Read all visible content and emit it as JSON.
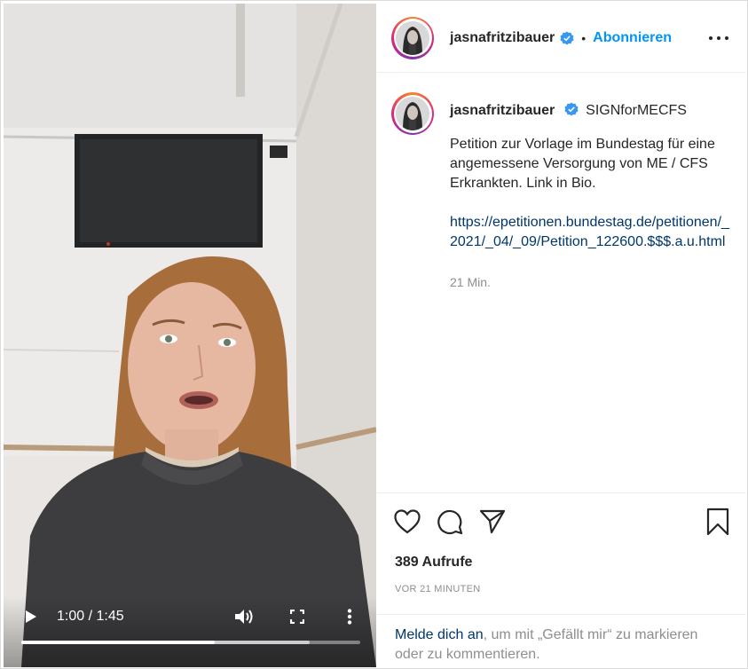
{
  "video": {
    "time_display": "1:00 / 1:45",
    "played_fraction": 0.571,
    "buffered_fraction": 0.85
  },
  "post": {
    "username": "jasnafritzibauer",
    "follow_label": "Abonnieren",
    "separator": "•",
    "hashtag": "SIGNforMECFS",
    "caption": "Petition zur Vorlage im Bundestag für eine angemessene Versorgung von ME / CFS Erkrankten. Link in Bio.",
    "link": "https://epetitionen.bundestag.de/petitionen/_2021/_04/_09/Petition_122600.$$$.a.u.html",
    "caption_time": "21 Min.",
    "views": "389 Aufrufe",
    "posted_ago": "VOR 21 MINUTEN"
  },
  "login_prompt": {
    "link_text": "Melde dich an",
    "rest_text": ", um mit „Gefällt mir“ zu markieren oder zu kommentieren."
  },
  "icons": [
    "play-icon",
    "volume-icon",
    "fullscreen-icon",
    "more-vertical-icon",
    "more-horizontal-icon",
    "verified-icon",
    "heart-icon",
    "comment-icon",
    "share-icon",
    "bookmark-icon"
  ],
  "colors": {
    "accent": "#0095f6",
    "link": "#00376b",
    "muted": "#8e8e8e",
    "text": "#262626"
  }
}
